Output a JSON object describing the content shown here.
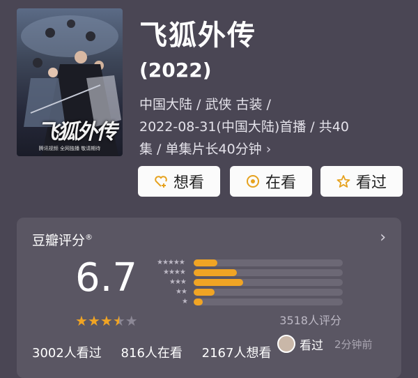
{
  "poster": {
    "title_art": "飞狐外传",
    "caption": "腾讯视频 全网独播 敬请期待"
  },
  "movie": {
    "title": "飞狐外传",
    "year": "(2022)",
    "meta_line1": "中国大陆 / 武侠 古装 /",
    "meta_line2": "2022-08-31(中国大陆)首播 / 共40",
    "meta_line3": "集 / 单集片长40分钟",
    "meta_arrow": "›"
  },
  "actions": {
    "want": {
      "label": "想看",
      "icon": "heart-plus-icon"
    },
    "watching": {
      "label": "在看",
      "icon": "circle-dot-icon"
    },
    "watched": {
      "label": "看过",
      "icon": "star-outline-icon"
    }
  },
  "rating": {
    "title": "豆瓣评分",
    "mark": "®",
    "chevron": "›",
    "score": "6.7",
    "stars_value": 3.5,
    "count_text": "3518人评分",
    "distribution": [
      {
        "stars": "★★★★★",
        "fraction": 0.16
      },
      {
        "stars": "★★★★",
        "fraction": 0.29
      },
      {
        "stars": "★★★",
        "fraction": 0.33
      },
      {
        "stars": "★★",
        "fraction": 0.14
      },
      {
        "stars": "★",
        "fraction": 0.06
      }
    ]
  },
  "stats": {
    "watched": "3002人看过",
    "watching": "816人在看",
    "want": "2167人想看"
  },
  "toast": {
    "action": "看过",
    "time": "2分钟前"
  },
  "colors": {
    "background": "#4a4654",
    "card": "#5a5663",
    "accent": "#f0a424",
    "button": "#fbfbfb"
  }
}
